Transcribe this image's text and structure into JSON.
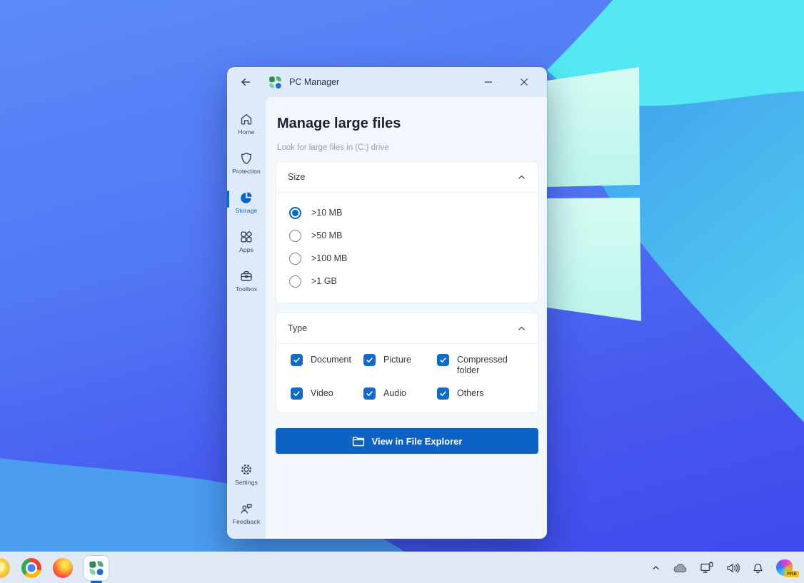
{
  "colors": {
    "accent": "#0B64C8",
    "button_blue": "#0C63C4",
    "checkbox_blue": "#0E6ACB",
    "window_chrome": "#DDEBF8",
    "content_bg": "#F1F7FD",
    "card_bg": "#FFFFFF",
    "taskbar_bg": "#E0E8F4",
    "wallpaper_cornflower": "#5178F5",
    "wallpaper_cyan": "#55E8F3",
    "wallpaper_mid_blue": "#3F9CEB",
    "wallpaper_indigo": "#4048EC",
    "wallpaper_pane": "#CBF9F0"
  },
  "window": {
    "title": "PC Manager",
    "controls": {
      "back": "back",
      "minimize": "minimize",
      "close": "close"
    }
  },
  "sidebar": {
    "items": [
      {
        "id": "home",
        "label": "Home",
        "active": false
      },
      {
        "id": "protection",
        "label": "Protection",
        "active": false
      },
      {
        "id": "storage",
        "label": "Storage",
        "active": true
      },
      {
        "id": "apps",
        "label": "Apps",
        "active": false
      },
      {
        "id": "toolbox",
        "label": "Toolbox",
        "active": false
      }
    ],
    "footer_items": [
      {
        "id": "settings",
        "label": "Settings"
      },
      {
        "id": "feedback",
        "label": "Feedback"
      }
    ]
  },
  "page": {
    "title": "Manage large files",
    "subtitle": "Look for large files in (C:) drive",
    "size_section": {
      "label": "Size",
      "collapsed": false,
      "options": [
        {
          "label": ">10 MB",
          "selected": true
        },
        {
          "label": ">50 MB",
          "selected": false
        },
        {
          "label": ">100 MB",
          "selected": false
        },
        {
          "label": ">1 GB",
          "selected": false
        }
      ]
    },
    "type_section": {
      "label": "Type",
      "collapsed": false,
      "options": [
        {
          "label": "Document",
          "checked": true
        },
        {
          "label": "Picture",
          "checked": true
        },
        {
          "label": "Compressed folder",
          "checked": true
        },
        {
          "label": "Video",
          "checked": true
        },
        {
          "label": "Audio",
          "checked": true
        },
        {
          "label": "Others",
          "checked": true
        }
      ]
    },
    "action_button": {
      "label": "View in File Explorer"
    }
  },
  "taskbar": {
    "pinned_apps": [
      "Chrome Canary",
      "Chrome",
      "Firefox",
      "PC Manager"
    ],
    "active_app": "PC Manager",
    "tray_icons": [
      "hidden-icons-chevron",
      "onedrive-cloud",
      "display-device",
      "volume",
      "notifications-bell",
      "copilot"
    ],
    "copilot_badge": "PRE"
  }
}
